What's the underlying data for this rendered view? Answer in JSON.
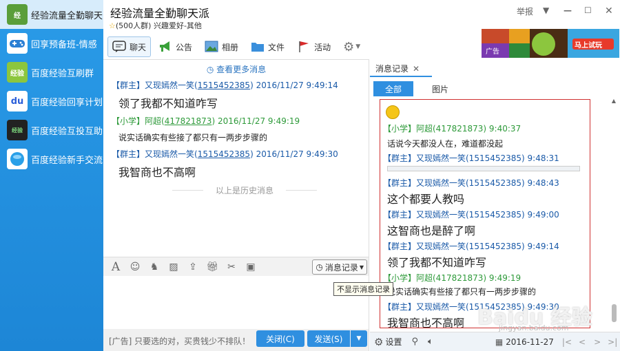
{
  "sidebar": {
    "items": [
      {
        "label": "经验流量全勤聊天",
        "icon": "experience-group-icon",
        "color": "#5a9e3a"
      },
      {
        "label": "回享预备班-情感",
        "icon": "gamepad-icon",
        "color": "#2a7fd4"
      },
      {
        "label": "百度经验互刷群",
        "icon": "experience-logo-icon",
        "color": "#8cc63e"
      },
      {
        "label": "百度经验回享计划",
        "icon": "baidu-paw-icon",
        "color": "#2b5fd9"
      },
      {
        "label": "百度经验互投互助",
        "icon": "dark-logo-icon",
        "color": "#222222"
      },
      {
        "label": "百度经验新手交流",
        "icon": "globe-icon",
        "color": "#2aa0e8"
      }
    ]
  },
  "header": {
    "title": "经验流量全勤聊天派",
    "subtitle": "(500人群) 兴趣爱好-其他",
    "report": "举报",
    "tabs": [
      "聊天",
      "公告",
      "相册",
      "文件",
      "活动"
    ],
    "ad": {
      "small": "广告",
      "cta": "马上试玩"
    }
  },
  "chat": {
    "more": "查看更多消息",
    "messages": [
      {
        "role": "【群主】",
        "name": "又现嫣然一笑",
        "qq": "1515452385",
        "time": "2016/11/27 9:49:14",
        "text": "领了我都不知道咋写",
        "big": true
      },
      {
        "role": "【小学】",
        "name": "阿超",
        "qq": "417821873",
        "time": "2016/11/27 9:49:19",
        "text": "说实话确实有些接了都只有一两步步骤的",
        "big": false
      },
      {
        "role": "【群主】",
        "name": "又现嫣然一笑",
        "qq": "1515452385",
        "time": "2016/11/27 9:49:30",
        "text": "我智商也不高啊",
        "big": true
      }
    ],
    "history": "以上是历史消息"
  },
  "toolbar": {
    "history_btn": "消息记录",
    "tooltip": "不显示消息记录"
  },
  "footer": {
    "ad_text": "[广告] 只要选的对，买贵钱少不排队！",
    "close": "关闭(C)",
    "send": "发送(S)"
  },
  "panel": {
    "tab": "消息记录",
    "subtabs": [
      "全部",
      "图片"
    ],
    "records": [
      {
        "head": "【小学】阿超(417821873) 9:40:37",
        "green": true,
        "text": "话说今天都没人在，难道都没起",
        "big": false
      },
      {
        "head": "【群主】又现嫣然一笑(1515452385) 9:48:31",
        "green": false,
        "text": "",
        "big": false
      },
      {
        "head": "【群主】又现嫣然一笑(1515452385) 9:48:43",
        "green": false,
        "text": "这个都要人教吗",
        "big": true
      },
      {
        "head": "【群主】又现嫣然一笑(1515452385) 9:49:00",
        "green": false,
        "text": "这智商也是醉了啊",
        "big": true
      },
      {
        "head": "【群主】又现嫣然一笑(1515452385) 9:49:14",
        "green": false,
        "text": "领了我都不知道咋写",
        "big": true
      },
      {
        "head": "【小学】阿超(417821873) 9:49:19",
        "green": true,
        "text": "说实话确实有些接了都只有一两步步骤的",
        "big": false
      },
      {
        "head": "【群主】又现嫣然一笑(1515452385) 9:49:30",
        "green": false,
        "text": "我智商也不高啊",
        "big": true
      }
    ],
    "settings": "设置",
    "date": "2016-11-27"
  },
  "watermark": {
    "logo": "Baidu 经验",
    "url": "jingyan.baidu.com"
  },
  "colors": {
    "accent": "#2f8fe0",
    "sidebar": "#1d86d6",
    "owner": "#1a5aa8",
    "member": "#2e9a3a"
  }
}
